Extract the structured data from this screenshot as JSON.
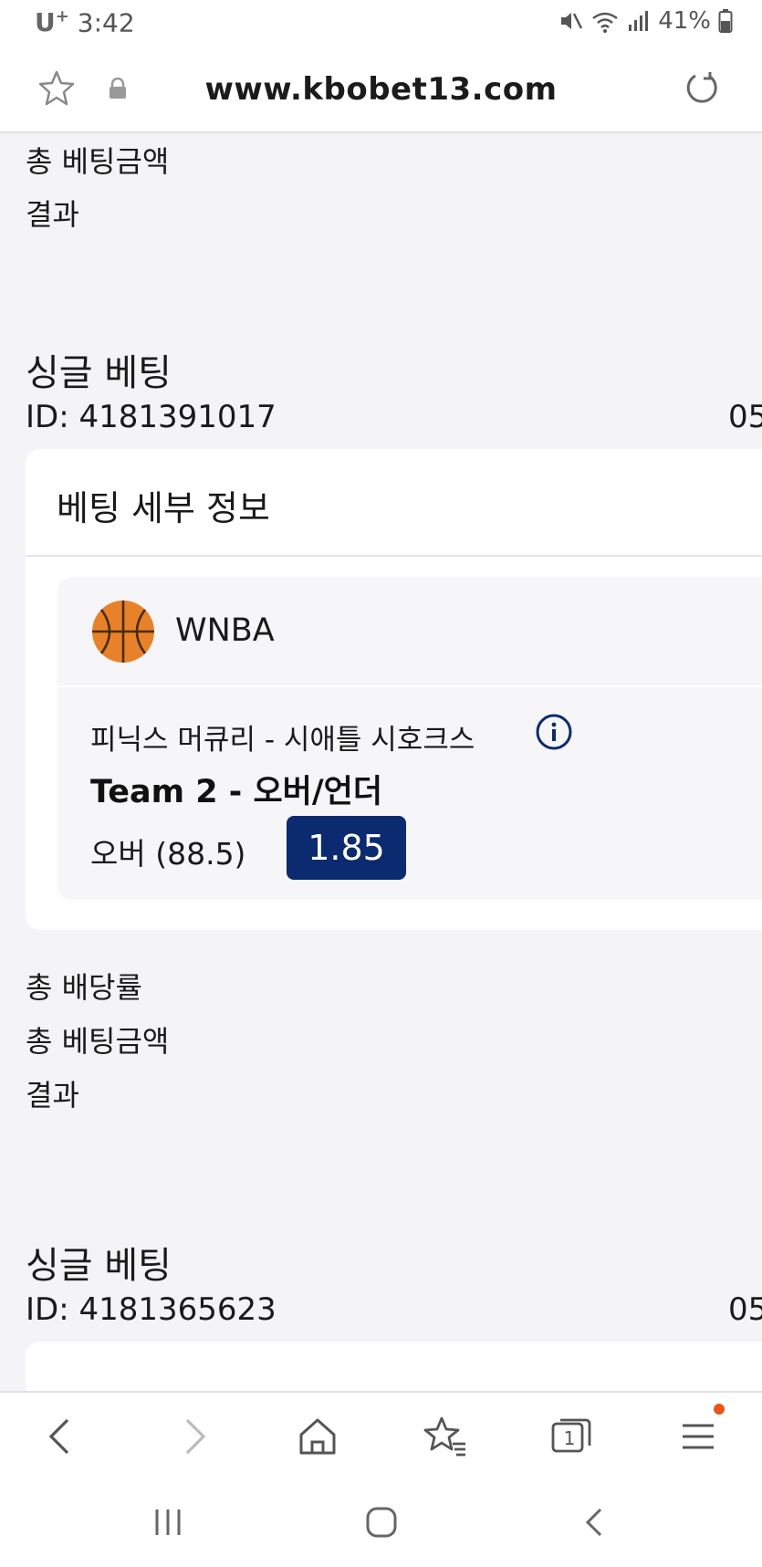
{
  "status_bar": {
    "carrier": "U",
    "carrier_sup": "+",
    "time": "3:42",
    "battery": "41%"
  },
  "address_bar": {
    "url": "www.kbobet13.com"
  },
  "bets": [
    {
      "rows": {
        "total_stake_label": "총 베팅금액",
        "result_label": "결과"
      }
    },
    {
      "type_label": "싱글 베팅",
      "id_text": "ID: 4181391017",
      "date_partial": "05",
      "details": {
        "header": "베팅 세부 정보",
        "league": "WNBA",
        "league_icon": "basketball-icon",
        "match": "피닉스 머큐리 - 시애틀 시호크스",
        "market": "Team 2 - 오버/언더",
        "selection": "오버 (88.5)",
        "odds": "1.85"
      },
      "rows": {
        "total_odds_label": "총 배당률",
        "total_stake_label": "총 베팅금액",
        "result_label": "결과"
      }
    },
    {
      "type_label": "싱글 베팅",
      "id_text": "ID: 4181365623",
      "date_partial": "05"
    }
  ],
  "bottom_toolbar": {
    "tab_count": "1",
    "menu_dot_color": "#e8561a"
  },
  "colors": {
    "odds_badge": "#0b2a6f",
    "page_bg": "#f4f4f6"
  }
}
